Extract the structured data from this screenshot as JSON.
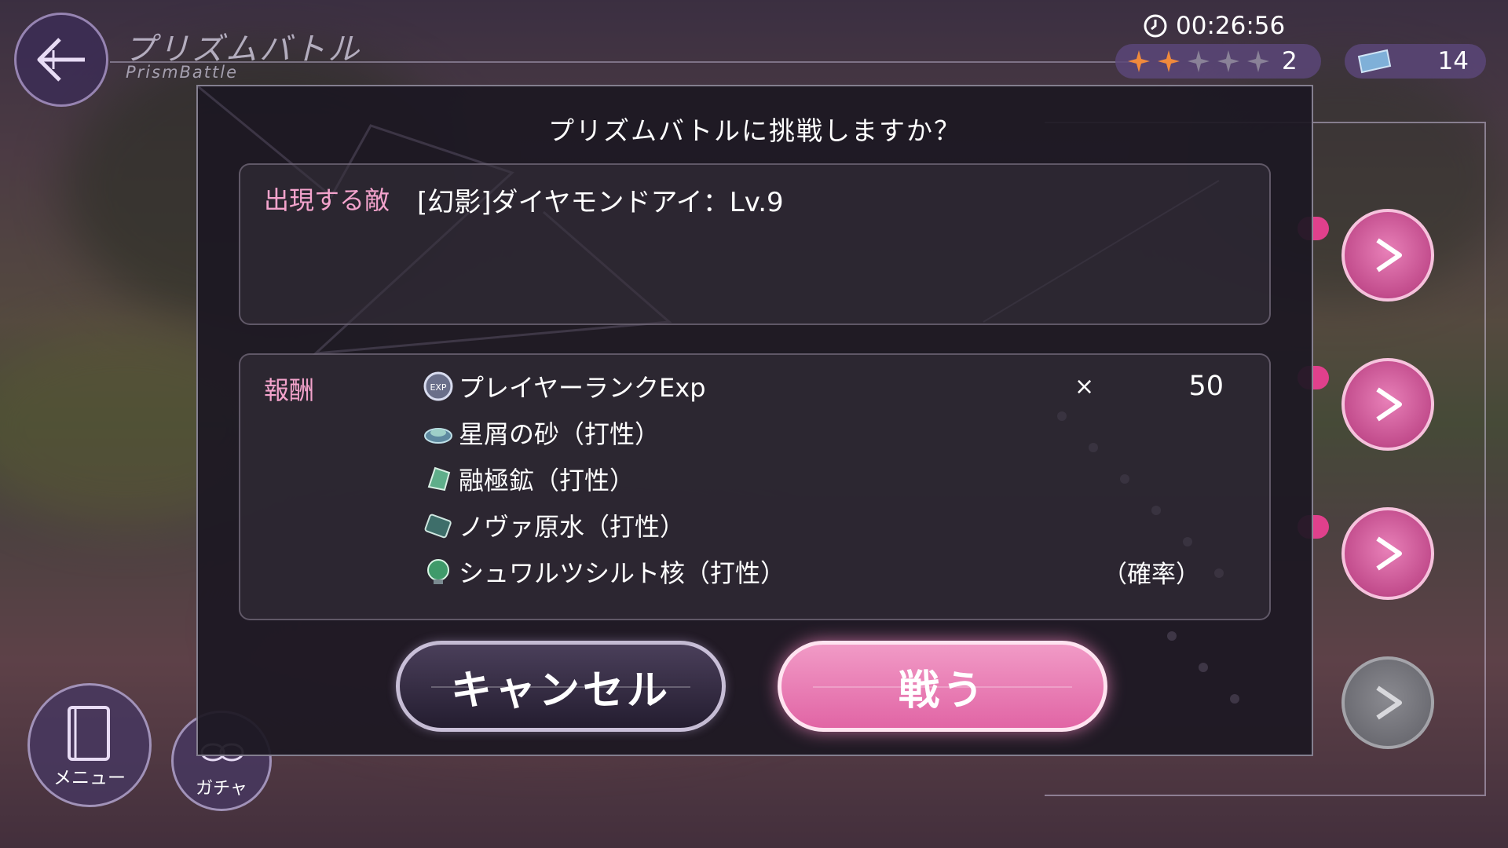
{
  "header": {
    "title_jp": "プリズムバトル",
    "title_en": "PrismBattle"
  },
  "status": {
    "timer": "00:26:56",
    "stars_filled": 2,
    "stars_total": 5,
    "stars_count": "2",
    "tickets": "14"
  },
  "dialog": {
    "title": "プリズムバトルに挑戦しますか？",
    "enemy_label": "出現する敵",
    "enemy_name": "[幻影]ダイヤモンドアイ：Lv.9",
    "reward_label": "報酬",
    "rewards": [
      {
        "icon": "exp-icon",
        "name": "プレイヤーランクExp",
        "multiplier": "×",
        "quantity": "50"
      },
      {
        "icon": "stardust-sand-icon",
        "name": "星屑の砂（打性）"
      },
      {
        "icon": "fusion-ore-icon",
        "name": "融極鉱（打性）"
      },
      {
        "icon": "nova-water-icon",
        "name": "ノヴァ原水（打性）"
      },
      {
        "icon": "schwarzschild-core-icon",
        "name": "シュワルツシルト核（打性）",
        "note": "（確率）"
      }
    ],
    "cancel_label": "キャンセル",
    "fight_label": "戦う"
  },
  "nav": {
    "menu_label": "メニュー",
    "gacha_label": "ガチャ"
  },
  "colors": {
    "accent_pink": "#e165a5",
    "label_pink": "#f3a3cc",
    "star_orange": "#f08a3c"
  }
}
